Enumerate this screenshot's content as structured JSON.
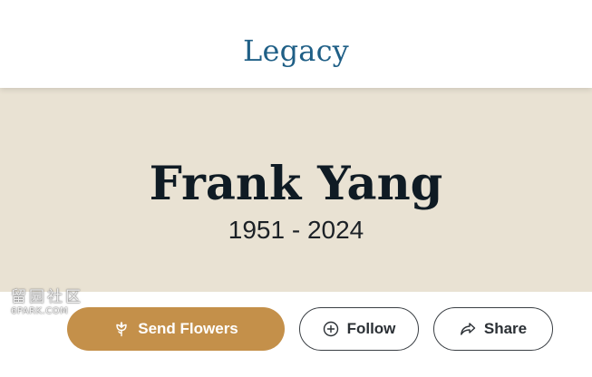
{
  "header": {
    "logo_text": "Legacy"
  },
  "hero": {
    "name": "Frank Yang",
    "years": "1951 - 2024"
  },
  "watermark": {
    "line1": "留园社区",
    "line2": "6PARK.COM"
  },
  "actions": {
    "send_flowers_label": "Send Flowers",
    "follow_label": "Follow",
    "share_label": "Share"
  },
  "icons": {
    "send_flowers": "flower-icon",
    "follow": "plus-circle-icon",
    "share": "share-arrow-icon"
  },
  "colors": {
    "logo": "#1f5f86",
    "hero_background": "#e9e2d3",
    "primary_button": "#c4904a",
    "name_text": "#0f1b24"
  }
}
